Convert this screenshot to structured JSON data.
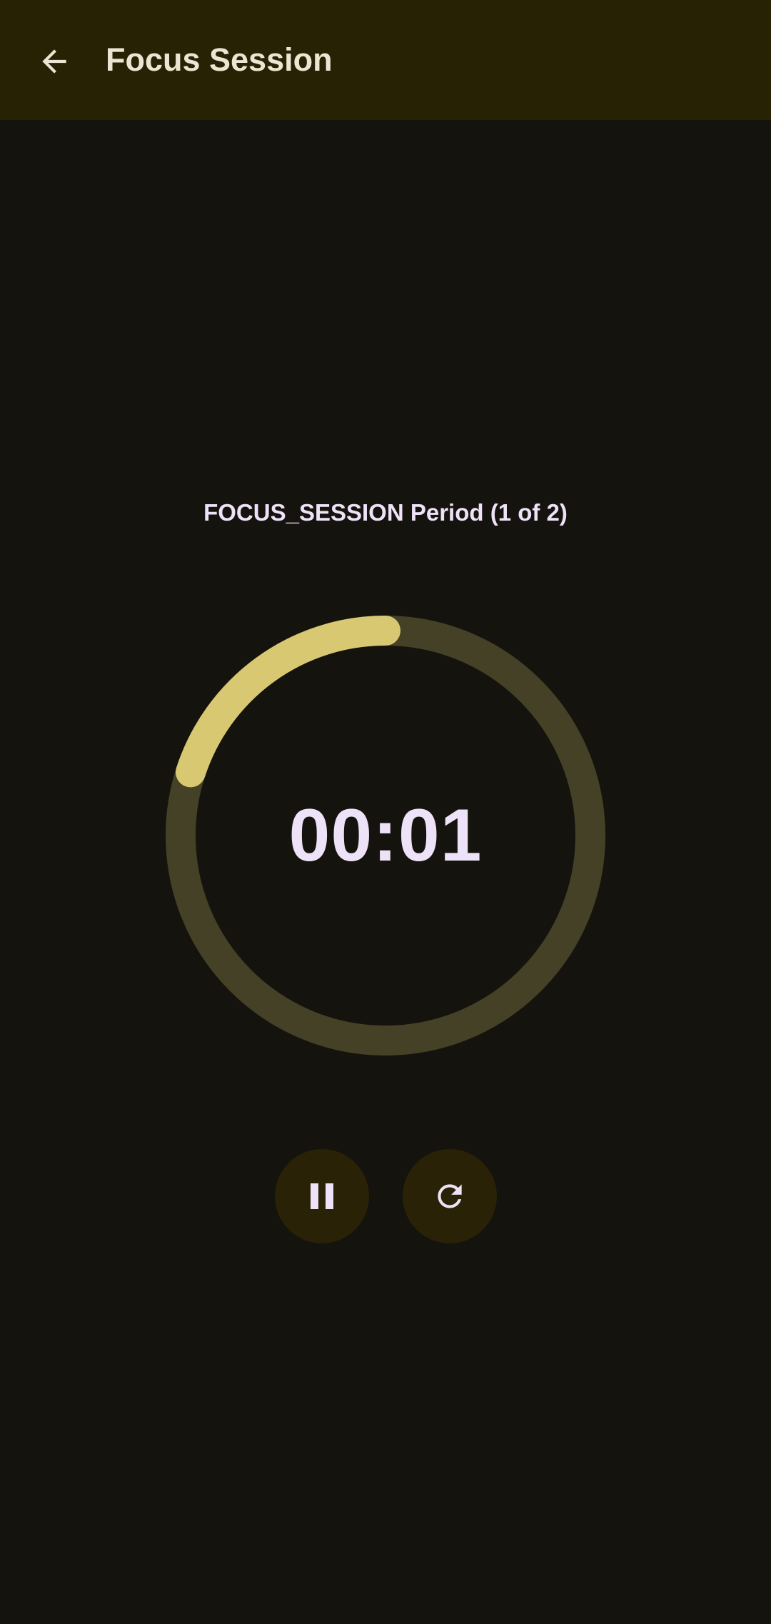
{
  "header": {
    "title": "Focus Session",
    "back_icon": "arrow-back-icon"
  },
  "timer": {
    "period_label": "FOCUS_SESSION Period (1 of 2)",
    "time": "00:01",
    "progress_fraction": 0.2
  },
  "controls": {
    "pause_icon": "pause-icon",
    "reset_icon": "refresh-icon"
  },
  "colors": {
    "background": "#15130d",
    "top_bar": "#272204",
    "ring_track": "#454127",
    "ring_progress": "#d9c872",
    "text_primary": "#ede2f7",
    "title_text": "#ede4d3",
    "button_bg": "#292206"
  }
}
